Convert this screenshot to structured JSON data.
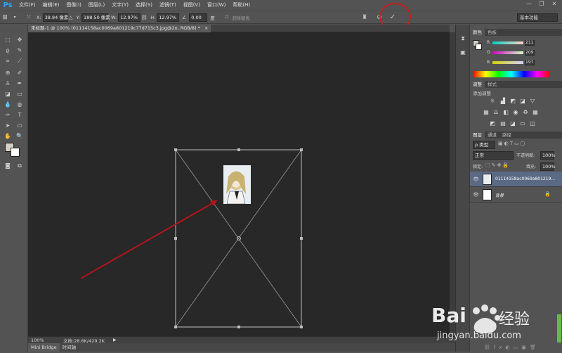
{
  "app": {
    "logo": "Ps"
  },
  "menu": [
    "文件(F)",
    "编辑(E)",
    "图像(I)",
    "图层(L)",
    "文字(Y)",
    "选择(S)",
    "滤镜(T)",
    "视图(V)",
    "窗口(W)",
    "帮助(H)"
  ],
  "window_controls": {
    "minimize": "—",
    "restore": "❐",
    "close": "✕"
  },
  "options": {
    "x_label": "X:",
    "x_value": "38.84 像素",
    "y_label": "Y:",
    "y_value": "188.50 像素",
    "w_label": "W:",
    "w_value": "12.97%",
    "h_label": "H:",
    "h_value": "12.97%",
    "angle_value": "0.00",
    "angle_unit": "度",
    "antialias_label": "消除锯齿",
    "cancel_icon": "⊘",
    "commit_icon": "✓",
    "workspace": "基本功能"
  },
  "document": {
    "tab_title": "未标题-1 @ 100% (01114158ac0069a801219c77d715c3.jpg@2o, RGB/8) *",
    "close": "×",
    "zoom": "100%",
    "doc_info": "文档:28.6K/429.2K"
  },
  "bottom_tabs": [
    "Mini Bridge",
    "时间轴"
  ],
  "color_panel": {
    "tabs": [
      "颜色",
      "色板"
    ],
    "r_label": "R",
    "r_value": "211",
    "g_label": "G",
    "g_value": "209",
    "b_label": "B",
    "b_value": "197",
    "fg_color": "#d3d1c5"
  },
  "adjust_panel": {
    "tabs": [
      "调整",
      "样式"
    ],
    "title": "添加调整"
  },
  "layers_panel": {
    "tabs": [
      "图层",
      "通道",
      "路径"
    ],
    "kind_filter": "ρ 类型",
    "blend_mode": "正常",
    "opacity_label": "不透明度:",
    "opacity_value": "100%",
    "lock_label": "锁定:",
    "fill_label": "填充:",
    "fill_value": "100%",
    "layers": [
      {
        "name": "01114158ac0069a801219...",
        "selected": true
      },
      {
        "name": "背景",
        "selected": false
      }
    ]
  },
  "watermark": {
    "brand": "Bai",
    "brand2": "经验",
    "url": "jingyan.baidu.com"
  },
  "colors": {
    "accent_red": "#c3201f",
    "canvas": "#282828",
    "chrome": "#535353",
    "selection": "#5a6a85"
  }
}
